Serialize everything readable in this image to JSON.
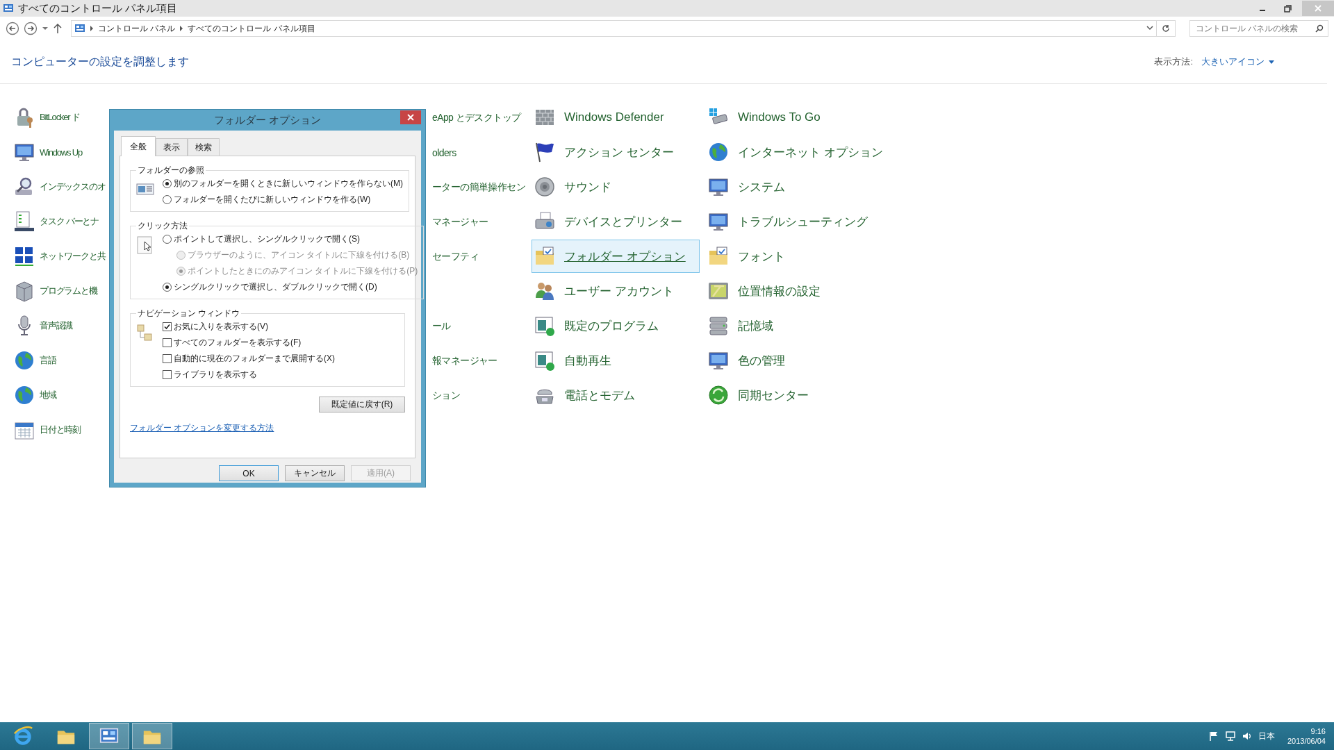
{
  "window": {
    "title": "すべてのコントロール パネル項目"
  },
  "address_bar": {
    "crumbs": [
      "コントロール パネル",
      "すべてのコントロール パネル項目"
    ]
  },
  "search": {
    "placeholder": "コントロール パネルの検索"
  },
  "header": {
    "title": "コンピューターの設定を調整します",
    "view_label": "表示方法:",
    "view_value": "大きいアイコン"
  },
  "columns": [
    {
      "items": [
        {
          "label": "BitLocker ド",
          "selected": false
        },
        {
          "label": "Windows Up",
          "selected": false
        },
        {
          "label": "インデックスのオ",
          "selected": false
        },
        {
          "label": "タスク バーとナ",
          "selected": false
        },
        {
          "label": "ネットワークと共",
          "selected": false
        },
        {
          "label": "プログラムと機",
          "selected": false
        },
        {
          "label": "音声認識",
          "selected": false
        },
        {
          "label": "言語",
          "selected": false
        },
        {
          "label": "地域",
          "selected": false
        },
        {
          "label": "日付と時刻",
          "selected": false
        }
      ]
    },
    {
      "items": [
        {
          "kind": "partial",
          "label": "eApp とデスクトップ"
        },
        {
          "kind": "partial",
          "label": "olders"
        },
        {
          "kind": "partial",
          "label": "ーターの簡単操作セン"
        },
        {
          "kind": "partial",
          "label": "マネージャー"
        },
        {
          "kind": "partial",
          "label": "セーフティ"
        },
        {
          "kind": "hidden"
        },
        {
          "kind": "partial",
          "label": "ール"
        },
        {
          "kind": "partial",
          "label": "報マネージャー"
        },
        {
          "kind": "partial",
          "label": "ション"
        }
      ]
    },
    {
      "items": [
        {
          "label": "Windows Defender",
          "selected": false
        },
        {
          "label": "アクション センター",
          "selected": false
        },
        {
          "label": "サウンド",
          "selected": false
        },
        {
          "label": "デバイスとプリンター",
          "selected": false
        },
        {
          "label": "フォルダー オプション",
          "selected": true
        },
        {
          "label": "ユーザー アカウント",
          "selected": false
        },
        {
          "label": "既定のプログラム",
          "selected": false
        },
        {
          "label": "自動再生",
          "selected": false
        },
        {
          "label": "電話とモデム",
          "selected": false
        }
      ]
    },
    {
      "items": [
        {
          "label": "Windows To Go",
          "selected": false
        },
        {
          "label": "インターネット オプション",
          "selected": false
        },
        {
          "label": "システム",
          "selected": false
        },
        {
          "label": "トラブルシューティング",
          "selected": false
        },
        {
          "label": "フォント",
          "selected": false
        },
        {
          "label": "位置情報の設定",
          "selected": false
        },
        {
          "label": "記憶域",
          "selected": false
        },
        {
          "label": "色の管理",
          "selected": false
        },
        {
          "label": "同期センター",
          "selected": false
        }
      ]
    }
  ],
  "dialog": {
    "title": "フォルダー オプション",
    "tabs": [
      {
        "label": "全般",
        "selected": true
      },
      {
        "label": "表示",
        "selected": false
      },
      {
        "label": "検索",
        "selected": false
      }
    ],
    "browse_group": {
      "legend": "フォルダーの参照",
      "options": [
        {
          "label": "別のフォルダーを開くときに新しいウィンドウを作らない(M)",
          "selected": true,
          "disabled": false
        },
        {
          "label": "フォルダーを開くたびに新しいウィンドウを作る(W)",
          "selected": false,
          "disabled": false
        }
      ]
    },
    "click_group": {
      "legend": "クリック方法",
      "options": [
        {
          "label": "ポイントして選択し、シングルクリックで開く(S)",
          "selected": false,
          "disabled": false,
          "children": [
            {
              "label": "ブラウザーのように、アイコン タイトルに下線を付ける(B)",
              "selected": false,
              "disabled": true
            },
            {
              "label": "ポイントしたときにのみアイコン タイトルに下線を付ける(P)",
              "selected": true,
              "disabled": true
            }
          ]
        },
        {
          "label": "シングルクリックで選択し、ダブルクリックで開く(D)",
          "selected": true,
          "disabled": false
        }
      ]
    },
    "nav_group": {
      "legend": "ナビゲーション ウィンドウ",
      "checks": [
        {
          "label": "お気に入りを表示する(V)",
          "checked": true
        },
        {
          "label": "すべてのフォルダーを表示する(F)",
          "checked": false
        },
        {
          "label": "自動的に現在のフォルダーまで展開する(X)",
          "checked": false
        },
        {
          "label": "ライブラリを表示する",
          "checked": false
        }
      ]
    },
    "restore_button": "既定値に戻す(R)",
    "help_link": "フォルダー オプションを変更する方法",
    "buttons": [
      {
        "label": "OK",
        "kind": "default",
        "disabled": false
      },
      {
        "label": "キャンセル",
        "kind": "normal",
        "disabled": false
      },
      {
        "label": "適用(A)",
        "kind": "normal",
        "disabled": true
      }
    ]
  },
  "taskbar": {
    "apps": [
      {
        "active": false
      },
      {
        "active": false
      },
      {
        "active": true
      },
      {
        "active": true
      }
    ],
    "language": "日本",
    "time": "9:16",
    "date": "2013/06/04"
  }
}
